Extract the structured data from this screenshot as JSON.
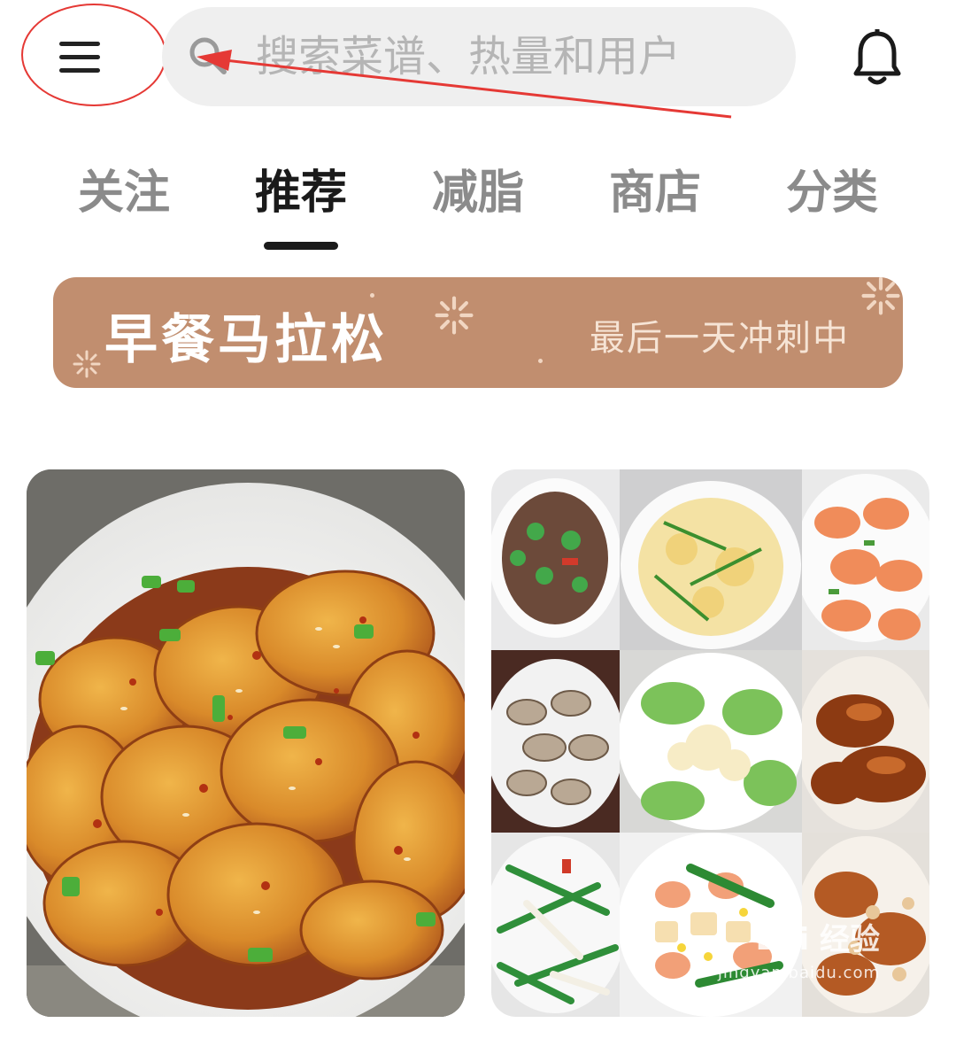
{
  "header": {
    "menu_icon": "hamburger-menu-icon",
    "search": {
      "placeholder": "搜索菜谱、热量和用户",
      "value": "",
      "icon": "search-icon"
    },
    "bell_icon": "bell-icon"
  },
  "tabs": [
    {
      "label": "关注",
      "active": false
    },
    {
      "label": "推荐",
      "active": true
    },
    {
      "label": "减脂",
      "active": false
    },
    {
      "label": "商店",
      "active": false
    },
    {
      "label": "分类",
      "active": false
    }
  ],
  "banner": {
    "title": "早餐马拉松",
    "subtitle": "最后一天冲刺中",
    "color": "#c18e6f"
  },
  "feed": {
    "cards": [
      {
        "image": "spicy-potato-slices-photo",
        "caption": ""
      },
      {
        "image": "home-dishes-collage-photo",
        "caption": ""
      }
    ]
  },
  "watermark": {
    "brand": "Bai 经验",
    "domain": "jingyan.baidu.com"
  },
  "annotation_color": "#e53935"
}
